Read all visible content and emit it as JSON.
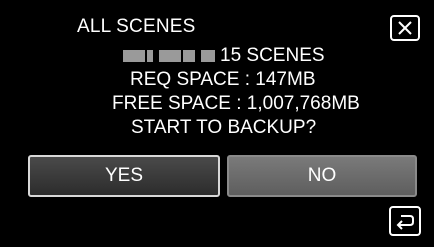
{
  "dialog": {
    "title": "ALL SCENES",
    "scene_count": "15 SCENES",
    "required_space": "REQ SPACE : 147MB",
    "free_space": "FREE SPACE : 1,007,768MB",
    "prompt": "START TO BACKUP?"
  },
  "buttons": {
    "yes_label": "YES",
    "no_label": "NO"
  },
  "icons": {
    "close": "close-icon",
    "back": "return-arrow-icon"
  },
  "colors": {
    "background": "#000000",
    "text": "#ffffff",
    "yes_button": "#3a3a3a",
    "no_button": "#6c6c6c"
  }
}
